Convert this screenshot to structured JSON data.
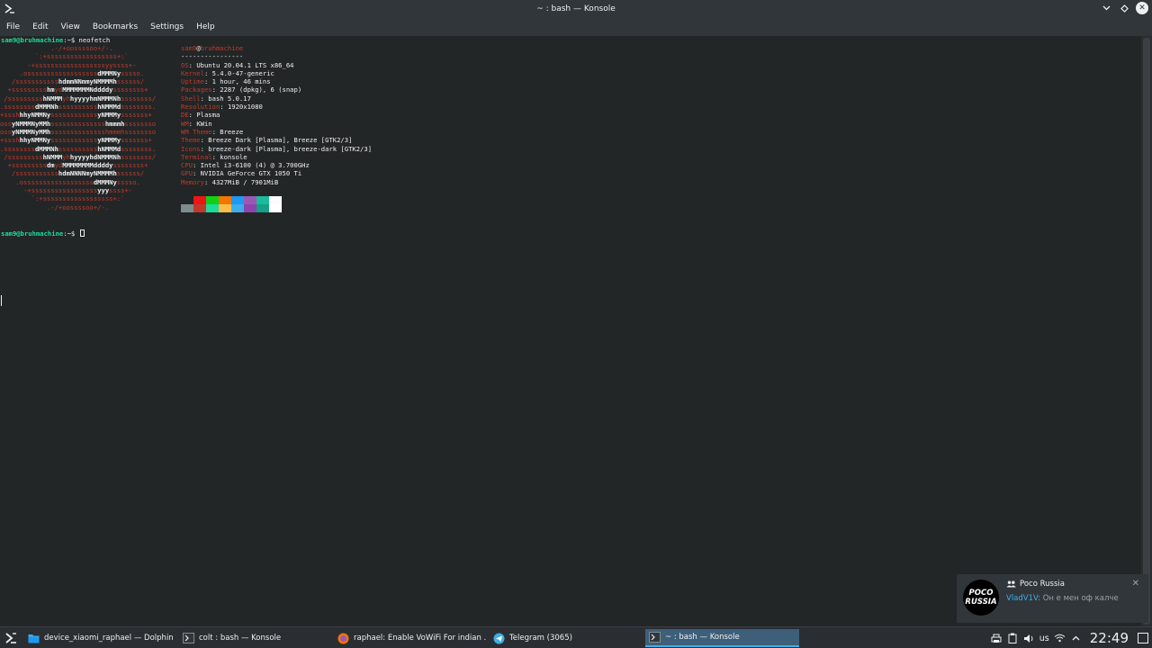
{
  "window": {
    "title": "~ : bash — Konsole"
  },
  "menubar": {
    "items": [
      "File",
      "Edit",
      "View",
      "Bookmarks",
      "Settings",
      "Help"
    ]
  },
  "terminal": {
    "prompt1_user": "sam9@bruhmachine",
    "prompt1_rest": ":~$ neofetch",
    "prompt2_user": "sam9@bruhmachine",
    "prompt2_rest": ":~$ ",
    "logo": [
      "             .-/+oossssoo+/-.",
      "         `:+ssssssssssssssssss+:`",
      "       -+ssssssssssssssssssyyssss+-",
      "     .ossssssssssssssssss|dMMMNy|sssso.",
      "   /sssssssssss|hdmmNNmmyNMMMMh|ssssss/",
      "  +sssssssss|hm|yd|MMMMMMMNddddy|ssssssss+",
      " /sssssssss|hNMMM|yh|hyyyyhmNMMMNh|ssssssss/",
      ".ssssssss|dMMMNh|ssssssssss|hNMMMd|ssssssss.",
      "+sssh|hhyNMMNy|ssssssssssss|yNMMMy|sssssss+",
      "oss|yNMMMNyMMh|ssssssssssssss|hmmmh|ssssssso",
      "oss|yNMMMNyMMh|sssssssssssssshmmmhssssssso",
      "+sssh|hhyNMMNy|ssssssssssss|yNMMMy|sssssss+",
      ".ssssssss|dMMMNh|ssssssssss|hNMMMd|ssssssss.",
      " /sssssssss|hNMMM|yh|hyyyyhdNMMMNh|ssssssss/",
      "  +sssssssss|dm|yd|MMMMMMMMddddy|ssssssss+",
      "   /sssssssssss|hdmNNNNmyNMMMMh|ssssss/",
      "    .ossssssssssssssssss|dMMMNy|sssso.",
      "      -+sssssssssssssssss|yyy|ssss+-",
      "        `:+ssssssssssssssssss+:`",
      "            .-/+oossssoo+/-."
    ],
    "info_user": "sam9",
    "info_at": "@",
    "info_host": "bruhmachine",
    "separator": "----------------",
    "info": [
      {
        "key": "OS",
        "value": "Ubuntu 20.04.1 LTS x86_64"
      },
      {
        "key": "Kernel",
        "value": "5.4.0-47-generic"
      },
      {
        "key": "Uptime",
        "value": "1 hour, 46 mins"
      },
      {
        "key": "Packages",
        "value": "2287 (dpkg), 6 (snap)"
      },
      {
        "key": "Shell",
        "value": "bash 5.0.17"
      },
      {
        "key": "Resolution",
        "value": "1920x1080"
      },
      {
        "key": "DE",
        "value": "Plasma"
      },
      {
        "key": "WM",
        "value": "KWin"
      },
      {
        "key": "WM Theme",
        "value": "Breeze"
      },
      {
        "key": "Theme",
        "value": "Breeze Dark [Plasma], Breeze [GTK2/3]"
      },
      {
        "key": "Icons",
        "value": "breeze-dark [Plasma], breeze-dark [GTK2/3]"
      },
      {
        "key": "Terminal",
        "value": "konsole"
      },
      {
        "key": "CPU",
        "value": "Intel i3-6100 (4) @ 3.700GHz"
      },
      {
        "key": "GPU",
        "value": "NVIDIA GeForce GTX 1050 Ti"
      },
      {
        "key": "Memory",
        "value": "4327MiB / 7901MiB"
      }
    ],
    "palette_top": [
      "#232627",
      "#ed1515",
      "#11d116",
      "#f67400",
      "#1d99f3",
      "#9b59b6",
      "#1abc9c",
      "#fcfcfc"
    ],
    "palette_bottom": [
      "#7f8c8d",
      "#c0392b",
      "#1cdc9a",
      "#fdbc4b",
      "#3daee9",
      "#8e44ad",
      "#16a085",
      "#ffffff"
    ]
  },
  "notification": {
    "title": "Poco Russia",
    "sender": "VladV1V",
    "message": ": Он е мен оф калче",
    "avatar_line1": "POCO",
    "avatar_line2": "RUSSIA"
  },
  "taskbar": {
    "tasks": [
      {
        "label": "device_xiaomi_raphael — Dolphin",
        "icon": "folder-icon"
      },
      {
        "label": "colt : bash — Konsole",
        "icon": "terminal-icon"
      },
      {
        "label": "raphael: Enable VoWiFi For indian ...",
        "icon": "firefox-icon"
      },
      {
        "label": "Telegram (3065)",
        "icon": "telegram-icon"
      },
      {
        "label": "~ : bash — Konsole",
        "icon": "terminal-icon"
      }
    ],
    "keyboard_layout": "us",
    "clock": "22:49"
  },
  "colors": {
    "accent": "#3daee9",
    "logo_red": "#c0392b",
    "prompt_green": "#1cdc9a"
  }
}
